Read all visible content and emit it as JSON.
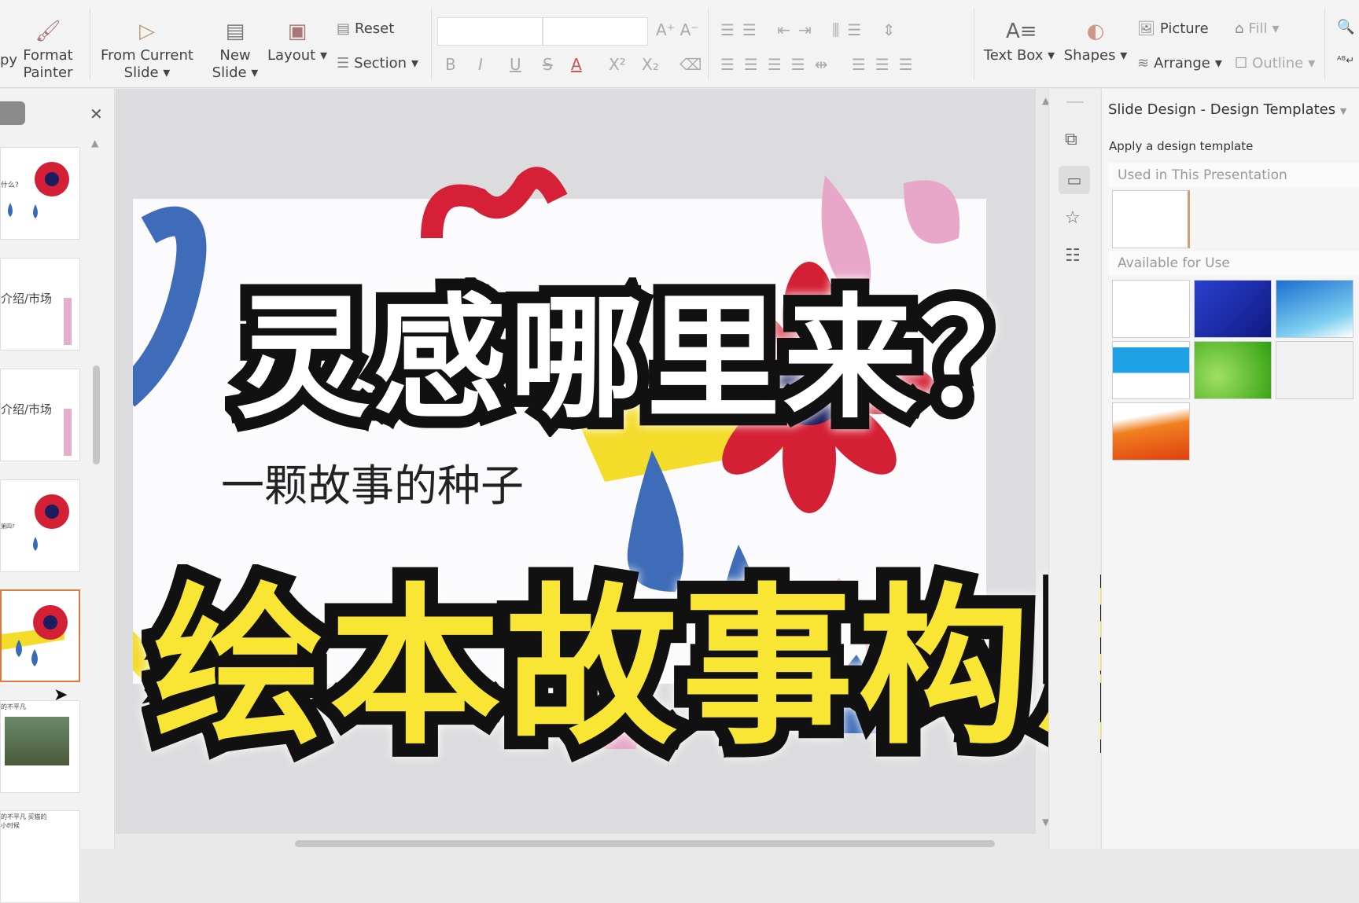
{
  "toolbar": {
    "copy_partial": "py",
    "format_painter": "Format Painter",
    "from_current_slide": "From Current Slide",
    "new_slide": "New Slide",
    "layout": "Layout",
    "reset": "Reset",
    "section": "Section",
    "format_buttons": [
      "B",
      "I",
      "U",
      "S",
      "A",
      "X²",
      "X₂",
      "⌫"
    ],
    "text_box": "Text Box",
    "shapes": "Shapes",
    "picture": "Picture",
    "arrange": "Arrange",
    "fill": "Fill",
    "outline": "Outline"
  },
  "thumbnails": [
    {
      "text": "什么?"
    },
    {
      "text": "介绍/市场"
    },
    {
      "text": "介绍/市场"
    },
    {
      "text": "第四?"
    },
    {
      "text": ""
    },
    {
      "text": "的不平凡"
    },
    {
      "text": "的不平凡 买猫的小时候"
    }
  ],
  "slide": {
    "title": "灵感哪里来？",
    "subtitle": "一颗故事的种子",
    "overlay_title": "绘本故事构思"
  },
  "design_panel": {
    "title": "Slide Design - Design Templates",
    "apply_label": "Apply a design template",
    "used_header": "Used in This Presentation",
    "available_header": "Available for Use",
    "template_colors": [
      "#ffffff",
      "#1c2fb0",
      "#2a8fd8",
      "#2aa6e0",
      "#40b820",
      "#f0f0f0",
      "#f06010"
    ]
  },
  "colors": {
    "accent": "#e07a3a",
    "title_yellow": "#f9e534"
  }
}
